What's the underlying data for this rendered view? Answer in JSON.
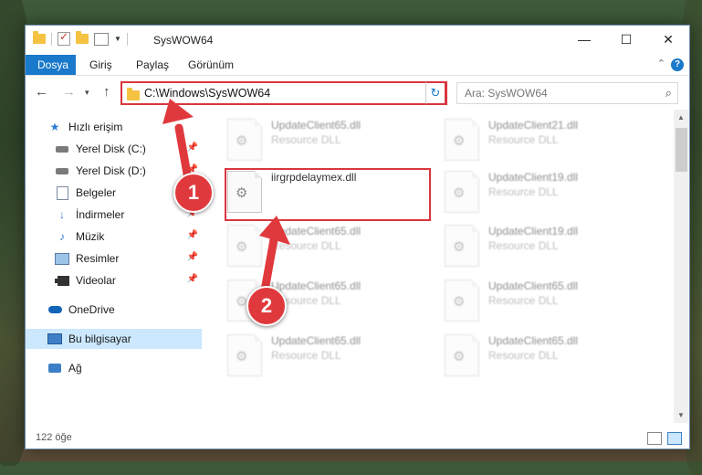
{
  "window": {
    "title": "SysWOW64",
    "controls": {
      "minimize": "—",
      "maximize": "☐",
      "close": "✕"
    }
  },
  "ribbon": {
    "tabs": [
      "Dosya",
      "Giriş",
      "Paylaş",
      "Görünüm"
    ],
    "help": "?"
  },
  "navigation": {
    "back_icon": "arrow-left-icon",
    "forward_icon": "arrow-right-icon",
    "up_icon": "arrow-up-icon",
    "address": "C:\\Windows\\SysWOW64",
    "search_placeholder": "Ara: SysWOW64"
  },
  "sidebar": {
    "items": [
      {
        "label": "Hızlı erişim",
        "icon": "star-icon",
        "pinned": false
      },
      {
        "label": "Yerel Disk (C:)",
        "icon": "drive-icon",
        "pinned": true
      },
      {
        "label": "Yerel Disk (D:)",
        "icon": "drive-icon",
        "pinned": true
      },
      {
        "label": "Belgeler",
        "icon": "document-icon",
        "pinned": true
      },
      {
        "label": "İndirmeler",
        "icon": "download-icon",
        "pinned": true
      },
      {
        "label": "Müzik",
        "icon": "music-icon",
        "pinned": true
      },
      {
        "label": "Resimler",
        "icon": "picture-icon",
        "pinned": true
      },
      {
        "label": "Videolar",
        "icon": "video-icon",
        "pinned": true
      },
      {
        "label": "OneDrive",
        "icon": "cloud-icon",
        "pinned": false
      },
      {
        "label": "Bu bilgisayar",
        "icon": "computer-icon",
        "pinned": false,
        "selected": true
      },
      {
        "label": "Ağ",
        "icon": "network-icon",
        "pinned": false
      }
    ]
  },
  "files": [
    {
      "name": "UpdateClient65.dll",
      "type": "Resource DLL",
      "blurred": true
    },
    {
      "name": "UpdateClient21.dll",
      "type": "Resource DLL",
      "blurred": true
    },
    {
      "name": "iirgrpdelaymex.dll",
      "type": "",
      "blurred": false,
      "highlighted": true
    },
    {
      "name": "UpdateClient19.dll",
      "type": "Resource DLL",
      "blurred": true
    },
    {
      "name": "UpdateClient65.dll",
      "type": "Resource DLL",
      "blurred": true
    },
    {
      "name": "UpdateClient19.dll",
      "type": "Resource DLL",
      "blurred": true
    },
    {
      "name": "UpdateClient65.dll",
      "type": "Resource DLL",
      "blurred": true
    },
    {
      "name": "UpdateClient65.dll",
      "type": "Resource DLL",
      "blurred": true
    },
    {
      "name": "UpdateClient65.dll",
      "type": "Resource DLL",
      "blurred": true
    },
    {
      "name": "UpdateClient65.dll",
      "type": "Resource DLL",
      "blurred": true
    }
  ],
  "status": {
    "count": "122 öğe"
  },
  "annotations": {
    "step1": "1",
    "step2": "2",
    "color": "#e0393d"
  }
}
